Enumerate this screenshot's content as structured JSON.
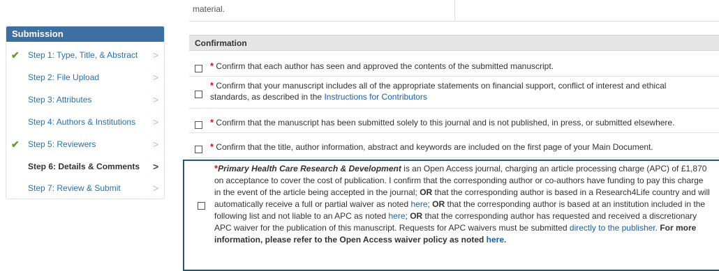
{
  "top": {
    "text": "material."
  },
  "sidebar": {
    "header": "Submission",
    "steps": [
      {
        "label": "Step 1: Type, Title, & Abstract",
        "checked": true,
        "active": false
      },
      {
        "label": "Step 2: File Upload",
        "checked": false,
        "active": false
      },
      {
        "label": "Step 3: Attributes",
        "checked": false,
        "active": false
      },
      {
        "label": "Step 4: Authors & Institutions",
        "checked": false,
        "active": false
      },
      {
        "label": "Step 5: Reviewers",
        "checked": true,
        "active": false
      },
      {
        "label": "Step 6: Details & Comments",
        "checked": false,
        "active": true
      },
      {
        "label": "Step 7: Review & Submit",
        "checked": false,
        "active": false
      }
    ],
    "check_glyph": "✔",
    "chevron_glyph": ">"
  },
  "confirmation": {
    "header": "Confirmation",
    "required_mark": "*",
    "items": {
      "approved": "Confirm that each author has seen and approved the contents of the submitted manuscript.",
      "statements_pre": "Confirm that your manuscript includes all of the appropriate statements on financial support, conflict of interest and ethical standards, as described in the ",
      "statements_link": "Instructions for Contributors",
      "solely": "Confirm that the manuscript has been submitted solely to this journal and is not published, in press, or submitted elsewhere.",
      "title_info": "Confirm that the title, author information, abstract and keywords are included on the first page of your Main Document."
    },
    "apc": {
      "journal": "Primary Health Care Research & Development",
      "p1": " is an Open Access journal, charging an article processing charge (APC) of £1,870 on acceptance to cover the cost of publication. I confirm that the corresponding author or co-authors have funding to pay this charge in the event of the article being accepted in the journal; ",
      "or1": "OR",
      "p2": " that the corresponding author is based in a Research4Life country and will automatically receive a full or partial waiver as noted ",
      "here1": "here",
      "p3": "; ",
      "or2": "OR",
      "p4": " that the corresponding author is based at an institution included in the following list and not liable to an APC as noted ",
      "here2": "here",
      "p5": "; ",
      "or3": "OR",
      "p6": " that the corresponding author has requested and received a discretionary APC waiver for the publication of this manuscript. Requests for APC waivers must be submitted ",
      "publisher_link": "directly to the publisher",
      "p7": ". ",
      "more_info": "For more information, please refer to the Open Access waiver policy as noted ",
      "here3": "here."
    }
  },
  "colors": {
    "sidebar_header": "#3d6fa0",
    "link": "#1a5fa8",
    "check": "#5aa02c",
    "required": "#dd1111",
    "highlight_border": "#1f5a7a"
  }
}
